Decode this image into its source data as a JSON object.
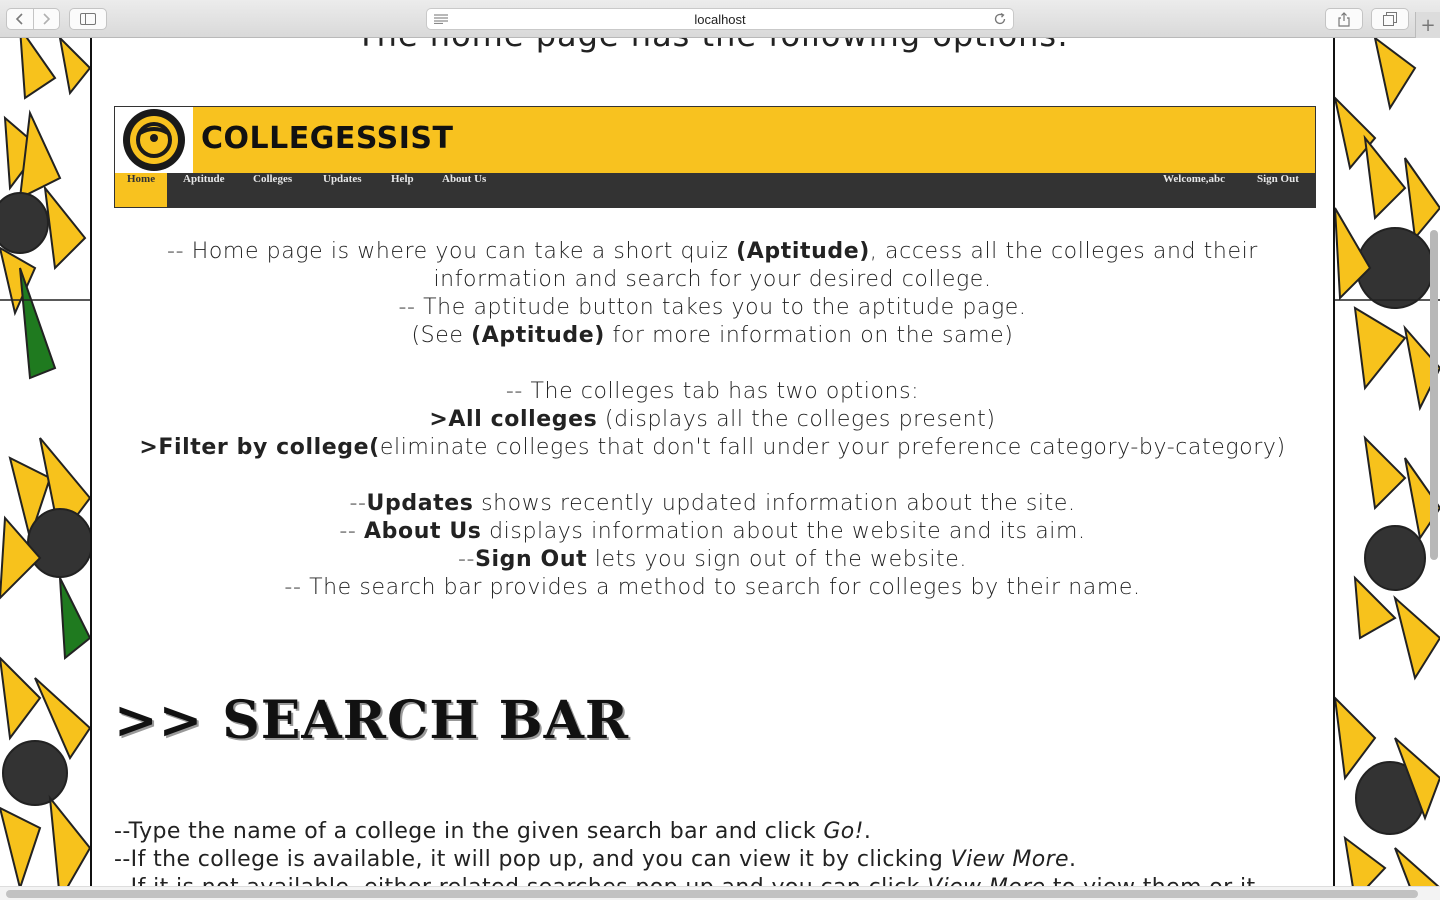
{
  "browser": {
    "url": "localhost",
    "new_tab_label": "+"
  },
  "page": {
    "top_heading_partial": "The home page has the following options:",
    "site_screenshot": {
      "brand": "COLLEGESSIST",
      "nav_items": [
        "Home",
        "Aptitude",
        "Colleges",
        "Updates",
        "Help",
        "About Us"
      ],
      "welcome": "Welcome,abc",
      "sign_out": "Sign Out"
    },
    "home_section": {
      "l1_pre": "-- Home page is where you can take a short quiz ",
      "l1_bold": "(Aptitude)",
      "l1_post": ", access all the colleges and their",
      "l2": "information and search for your desired college.",
      "l3": "-- The aptitude button takes you to the aptitude page.",
      "l4_pre": "(See ",
      "l4_bold": "(Aptitude)",
      "l4_post": " for more information on the same)",
      "l5": "-- The colleges tab has two options:",
      "l6_bold": ">All colleges",
      "l6_post": " (displays all the colleges present)",
      "l7_bold": ">Filter by college(",
      "l7_post": "eliminate colleges that don't fall under your preference category-by-category)",
      "l8_pre": "--",
      "l8_bold": "Updates",
      "l8_post": " shows recently updated information about the site.",
      "l9_pre": "-- ",
      "l9_bold": "About Us",
      "l9_post": " displays information about the website and its aim.",
      "l10_pre": "--",
      "l10_bold": "Sign Out",
      "l10_post": " lets you sign out of the website.",
      "l11": "-- The search bar provides a method to search for colleges by their name."
    },
    "search_section": {
      "heading": ">> SEARCH BAR",
      "l1_pre": "--Type the name of a college in the given search bar and click ",
      "l1_em": "Go!",
      "l1_post": ".",
      "l2_pre": "--If the college is available, it will pop up, and you can view it by clicking ",
      "l2_em": "View More",
      "l2_post": ".",
      "l3_pre": "--If it is not available, either related searches pop up and you can click ",
      "l3_em": "View More",
      "l3_post": " to view them or it"
    }
  }
}
